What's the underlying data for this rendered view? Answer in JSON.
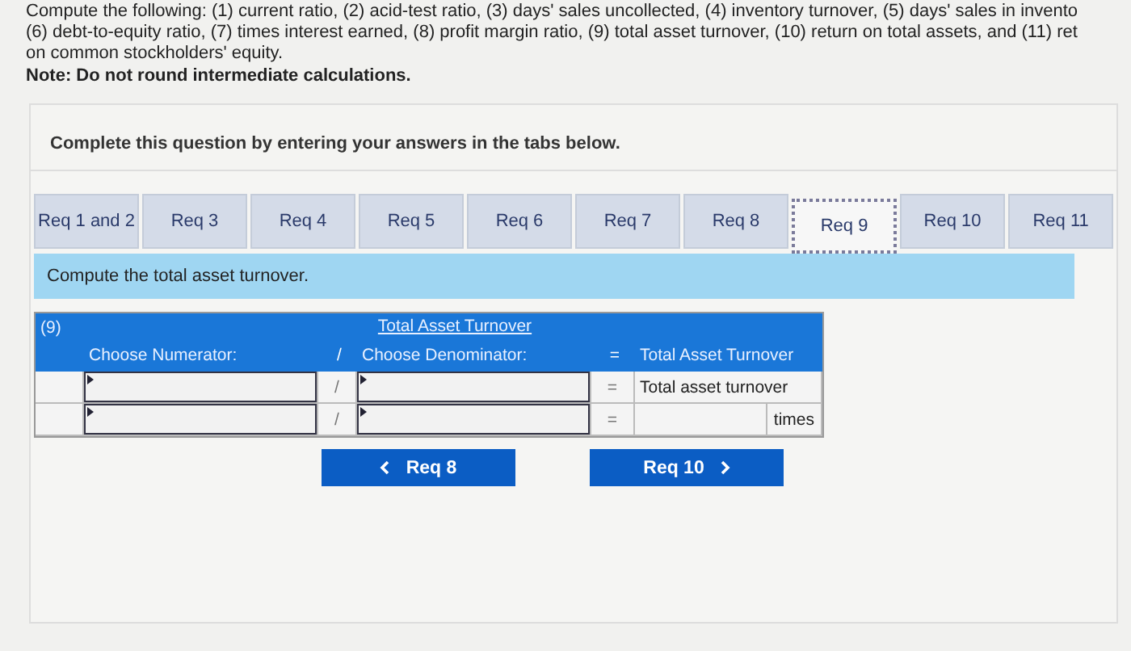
{
  "instructions": {
    "lines": [
      "Compute the following: (1) current ratio, (2) acid-test ratio, (3) days' sales uncollected, (4) inventory turnover, (5) days' sales in invento",
      "(6) debt-to-equity ratio, (7) times interest earned, (8) profit margin ratio, (9) total asset turnover, (10) return on total assets, and (11) ret",
      "on common stockholders' equity."
    ],
    "note": "Note: Do not round intermediate calculations."
  },
  "card": {
    "prompt": "Complete this question by entering your answers in the tabs below.",
    "tabs": [
      {
        "label": "Req 1 and 2",
        "selected": false
      },
      {
        "label": "Req 3",
        "selected": false
      },
      {
        "label": "Req 4",
        "selected": false
      },
      {
        "label": "Req 5",
        "selected": false
      },
      {
        "label": "Req 6",
        "selected": false
      },
      {
        "label": "Req 7",
        "selected": false
      },
      {
        "label": "Req 8",
        "selected": false
      },
      {
        "label": "Req 9",
        "selected": true
      },
      {
        "label": "Req 10",
        "selected": false
      },
      {
        "label": "Req 11",
        "selected": false
      }
    ],
    "task": "Compute the total asset turnover.",
    "table": {
      "label": "(9)",
      "title": "Total Asset Turnover",
      "header": {
        "numerator": "Choose Numerator:",
        "divide": "/",
        "denominator": "Choose Denominator:",
        "equals": "=",
        "result": "Total Asset Turnover"
      },
      "rows": [
        {
          "divide": "/",
          "equals": "=",
          "result": "Total asset turnover"
        },
        {
          "divide": "/",
          "equals": "=",
          "unit": "times"
        }
      ]
    },
    "nav": [
      {
        "label": "Req 8",
        "kind": "prev"
      },
      {
        "label": "Req 10",
        "kind": "next"
      }
    ]
  }
}
